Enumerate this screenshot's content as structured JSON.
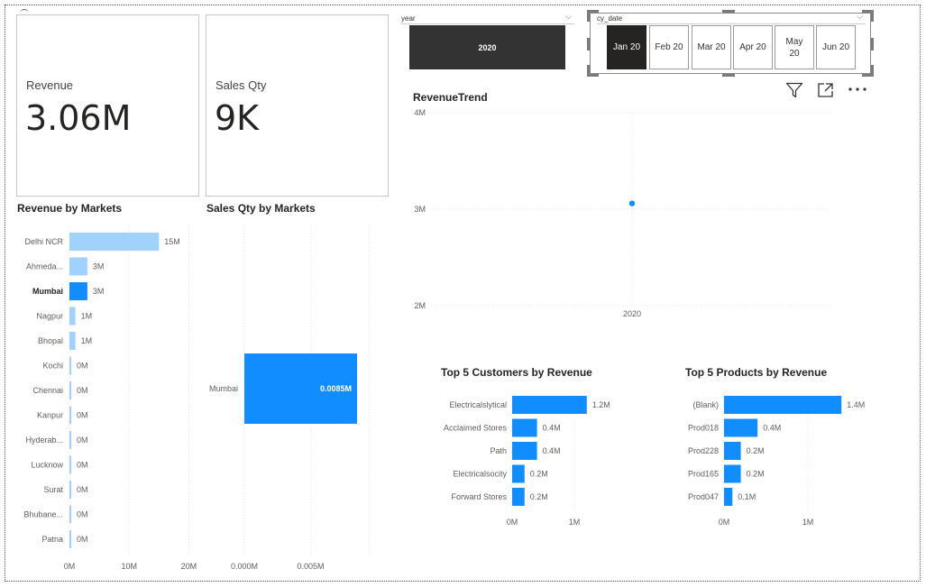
{
  "cards": {
    "revenue": {
      "label": "Revenue",
      "value": "3.06M"
    },
    "sales_qty": {
      "label": "Sales Qty",
      "value": "9K"
    }
  },
  "slicers": {
    "year": {
      "title": "year",
      "options": [
        "2020"
      ],
      "selected": "2020"
    },
    "cy_date": {
      "title": "cy_date",
      "options": [
        "Jan 20",
        "Feb 20",
        "Mar 20",
        "Apr 20",
        "May 20",
        "Jun 20"
      ],
      "selected": "Jan 20"
    }
  },
  "colors": {
    "accent": "#118DFF",
    "light_bar": "#A0D1FF",
    "slicer_selected": "#252423",
    "year_button": "#333333"
  },
  "icons": [
    "filter-icon",
    "focus-mode-icon",
    "more-options-icon"
  ],
  "chart_data": [
    {
      "type": "bar",
      "title": "Revenue by Markets",
      "orientation": "horizontal",
      "categories": [
        "Delhi NCR",
        "Ahmeda...",
        "Mumbai",
        "Nagpur",
        "Bhopal",
        "Kochi",
        "Chennai",
        "Kanpur",
        "Hyderab...",
        "Lucknow",
        "Surat",
        "Bhubane...",
        "Patna"
      ],
      "values": [
        15,
        3,
        3,
        1,
        1,
        0.2,
        0.2,
        0.2,
        0.2,
        0.2,
        0.2,
        0.2,
        0.2
      ],
      "value_labels": [
        "15M",
        "3M",
        "3M",
        "1M",
        "1M",
        "0M",
        "0M",
        "0M",
        "0M",
        "0M",
        "0M",
        "0M",
        "0M"
      ],
      "highlighted": "Mumbai",
      "x_ticks": [
        "0M",
        "10M",
        "20M"
      ],
      "xlim": [
        0,
        20
      ],
      "grid": true
    },
    {
      "type": "bar",
      "title": "Sales Qty by Markets",
      "orientation": "horizontal",
      "categories": [
        "Mumbai"
      ],
      "values": [
        0.0085
      ],
      "value_labels": [
        "0.0085M"
      ],
      "x_ticks": [
        "0.000M",
        "0.005M"
      ],
      "xlim": [
        0,
        0.009
      ],
      "grid": true
    },
    {
      "type": "scatter",
      "title": "RevenueTrend",
      "x": [
        "2020"
      ],
      "y": [
        3.06
      ],
      "y_ticks": [
        "4M",
        "3M",
        "2M"
      ],
      "ylim": [
        2,
        4
      ],
      "grid": true
    },
    {
      "type": "bar",
      "title": "Top 5 Customers by Revenue",
      "orientation": "horizontal",
      "categories": [
        "Electricalslytical",
        "Acclaimed Stores",
        "Path",
        "Electricalsocity",
        "Forward Stores"
      ],
      "values": [
        1.2,
        0.4,
        0.4,
        0.2,
        0.2
      ],
      "value_labels": [
        "1.2M",
        "0.4M",
        "0.4M",
        "0.2M",
        "0.2M"
      ],
      "x_ticks": [
        "0M",
        "1M"
      ],
      "xlim": [
        0,
        1.5
      ]
    },
    {
      "type": "bar",
      "title": "Top 5 Products by Revenue",
      "orientation": "horizontal",
      "categories": [
        "(Blank)",
        "Prod018",
        "Prod228",
        "Prod165",
        "Prod047"
      ],
      "values": [
        1.4,
        0.4,
        0.2,
        0.2,
        0.1
      ],
      "value_labels": [
        "1.4M",
        "0.4M",
        "0.2M",
        "0.2M",
        "0.1M"
      ],
      "x_ticks": [
        "0M",
        "1M"
      ],
      "xlim": [
        0,
        1.5
      ]
    }
  ]
}
